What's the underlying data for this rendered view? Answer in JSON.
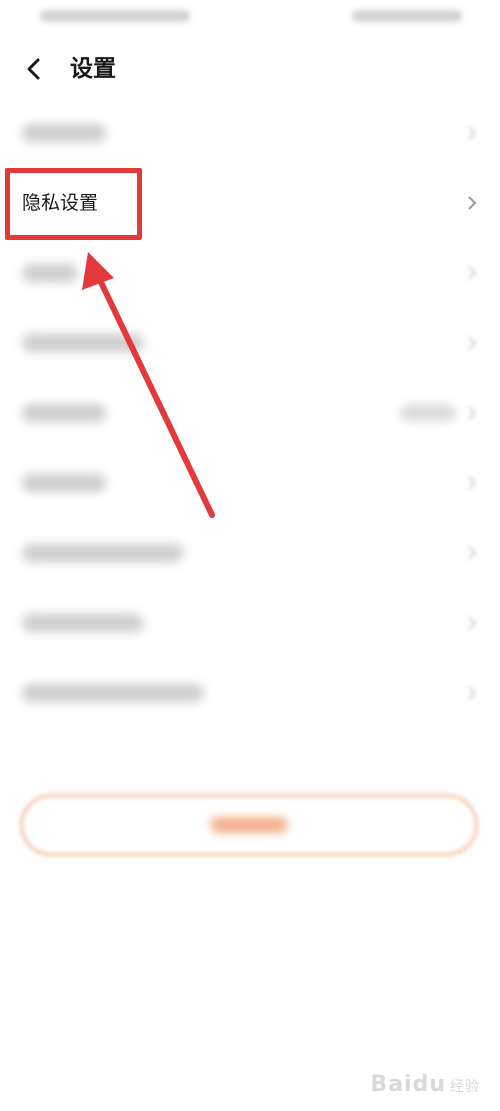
{
  "nav": {
    "title": "设置"
  },
  "settings": {
    "privacy_label": "隐私设置"
  },
  "watermark": {
    "brand": "Baidu",
    "sub": "经验"
  },
  "colors": {
    "accent_red": "#e4393c",
    "logout_orange": "#f1a47a",
    "text_primary": "#1a1a1a"
  },
  "icons": {
    "back": "back-chevron-icon",
    "row_arrow": "chevron-right-icon"
  }
}
